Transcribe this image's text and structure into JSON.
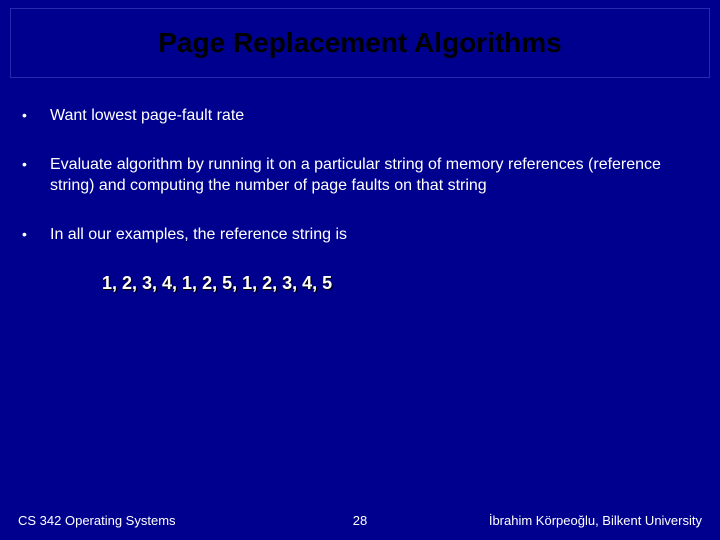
{
  "title": "Page Replacement Algorithms",
  "bullets": [
    "Want lowest page-fault rate",
    "Evaluate algorithm by running it on a particular string of memory references (reference string) and computing the number of page faults on that string",
    "In all our examples, the reference string is"
  ],
  "reference_string": "1, 2, 3, 4, 1, 2, 5, 1, 2, 3, 4, 5",
  "footer": {
    "left": "CS 342 Operating Systems",
    "center": "28",
    "right": "İbrahim Körpeoğlu, Bilkent University"
  }
}
